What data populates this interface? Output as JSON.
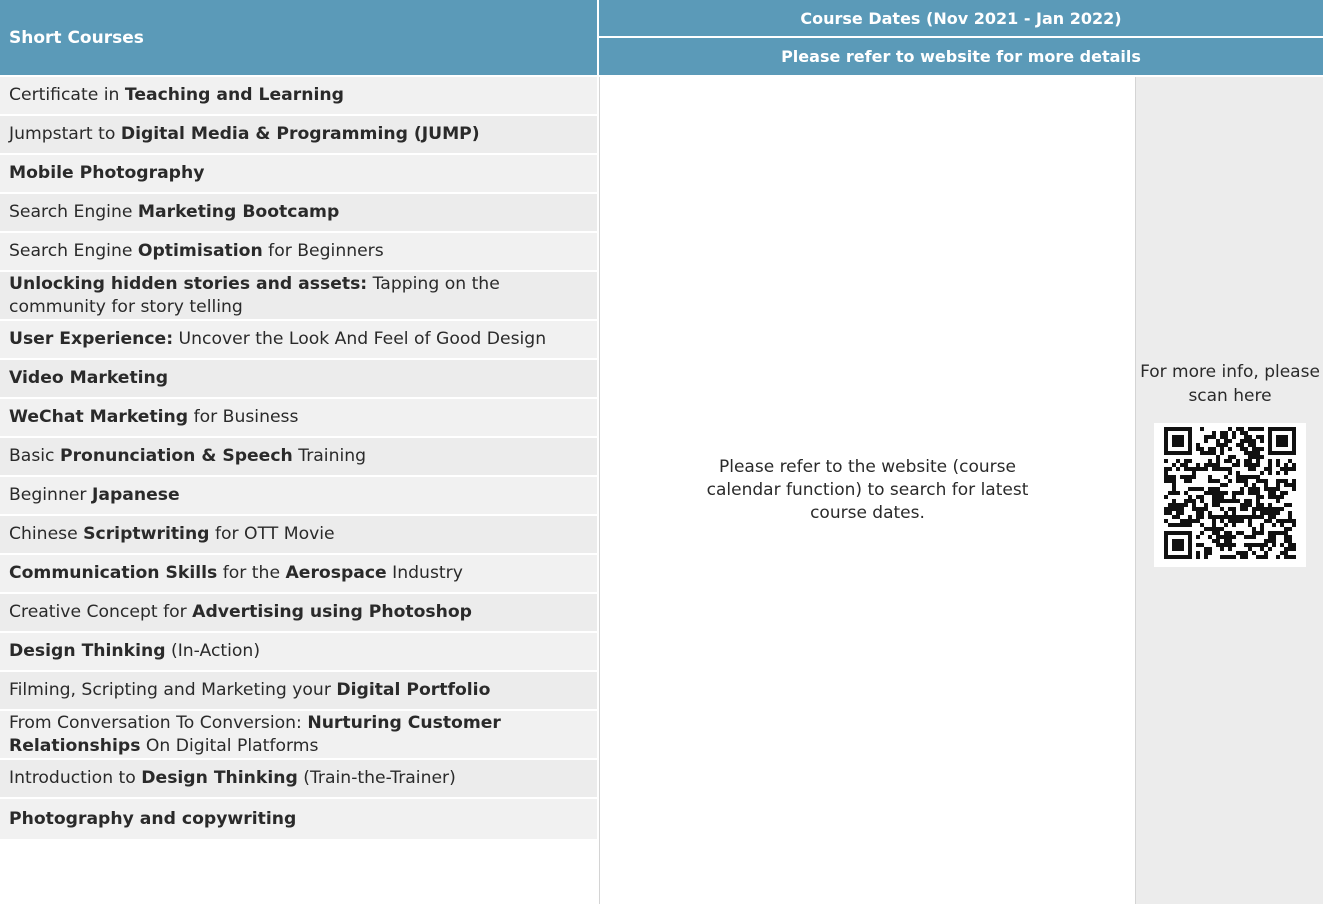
{
  "header": {
    "courses_label": "Short Courses",
    "dates_label": "Course Dates (Nov 2021 - Jan 2022)",
    "website_note": "Please refer to website for more details"
  },
  "courses": [
    {
      "parts": [
        {
          "t": "Certificate in ",
          "b": false
        },
        {
          "t": "Teaching and Learning",
          "b": true
        }
      ]
    },
    {
      "parts": [
        {
          "t": "Jumpstart to ",
          "b": false
        },
        {
          "t": "Digital Media & Programming (JUMP)",
          "b": true
        }
      ]
    },
    {
      "parts": [
        {
          "t": "Mobile Photography",
          "b": true
        }
      ]
    },
    {
      "parts": [
        {
          "t": "Search Engine ",
          "b": false
        },
        {
          "t": "Marketing Bootcamp",
          "b": true
        }
      ]
    },
    {
      "parts": [
        {
          "t": "Search Engine ",
          "b": false
        },
        {
          "t": "Optimisation",
          "b": true
        },
        {
          "t": " for Beginners",
          "b": false
        }
      ]
    },
    {
      "parts": [
        {
          "t": "Unlocking hidden stories and assets:",
          "b": true
        },
        {
          "t": " Tapping on the community for story telling",
          "b": false
        }
      ]
    },
    {
      "parts": [
        {
          "t": "User Experience:",
          "b": true
        },
        {
          "t": " Uncover the Look And Feel of Good Design",
          "b": false
        }
      ]
    },
    {
      "parts": [
        {
          "t": "Video Marketing",
          "b": true
        }
      ]
    },
    {
      "parts": [
        {
          "t": "WeChat Marketing",
          "b": true
        },
        {
          "t": " for Business",
          "b": false
        }
      ]
    },
    {
      "parts": [
        {
          "t": "Basic ",
          "b": false
        },
        {
          "t": "Pronunciation & Speech",
          "b": true
        },
        {
          "t": " Training",
          "b": false
        }
      ]
    },
    {
      "parts": [
        {
          "t": "Beginner ",
          "b": false
        },
        {
          "t": "Japanese",
          "b": true
        }
      ]
    },
    {
      "parts": [
        {
          "t": "Chinese ",
          "b": false
        },
        {
          "t": "Scriptwriting",
          "b": true
        },
        {
          "t": " for OTT Movie",
          "b": false
        }
      ]
    },
    {
      "parts": [
        {
          "t": "Communication Skills",
          "b": true
        },
        {
          "t": " for the ",
          "b": false
        },
        {
          "t": "Aerospace",
          "b": true
        },
        {
          "t": " Industry",
          "b": false
        }
      ]
    },
    {
      "parts": [
        {
          "t": "Creative Concept for ",
          "b": false
        },
        {
          "t": "Advertising using Photoshop",
          "b": true
        }
      ]
    },
    {
      "parts": [
        {
          "t": "Design Thinking",
          "b": true
        },
        {
          "t": " (In-Action)",
          "b": false
        }
      ]
    },
    {
      "parts": [
        {
          "t": "Filming, Scripting and Marketing your ",
          "b": false
        },
        {
          "t": "Digital Portfolio",
          "b": true
        }
      ]
    },
    {
      "parts": [
        {
          "t": "From Conversation To Conversion: ",
          "b": false
        },
        {
          "t": "Nurturing Customer Relationships",
          "b": true
        },
        {
          "t": " On Digital Platforms",
          "b": false
        }
      ]
    },
    {
      "parts": [
        {
          "t": "Introduction to ",
          "b": false
        },
        {
          "t": "Design Thinking",
          "b": true
        },
        {
          "t": " (Train-the-Trainer)",
          "b": false
        }
      ]
    },
    {
      "parts": [
        {
          "t": "Photography and copywriting",
          "b": true
        }
      ]
    }
  ],
  "dates_info": "Please refer to the website (course calendar function) to search for latest course dates.",
  "qr": {
    "caption": "For more info, please scan here",
    "icon": "qr-code-icon"
  },
  "colors": {
    "header_bg": "#5b9ab8",
    "row_light": "#f1f1f1",
    "row_dark": "#ececec"
  }
}
